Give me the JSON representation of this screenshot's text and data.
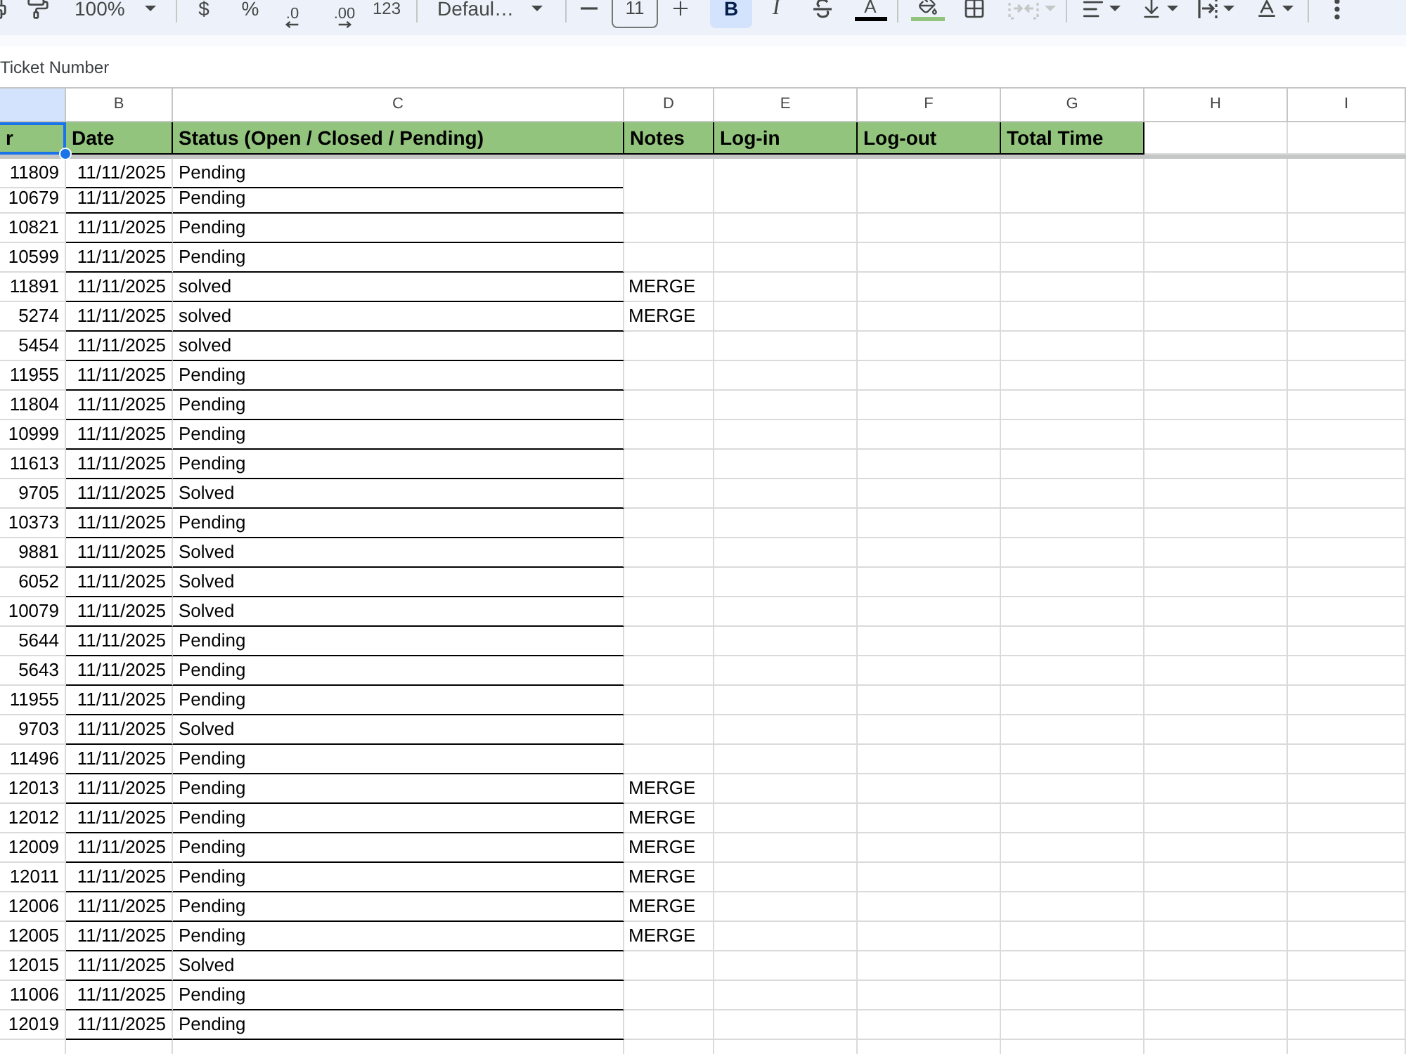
{
  "toolbar": {
    "zoom": "100%",
    "number_formats": [
      {
        "label": "$",
        "kind": "text"
      },
      {
        "label": "%",
        "kind": "text"
      },
      {
        "label": ".0",
        "kind": "decrease"
      },
      {
        "label": ".00",
        "kind": "increase"
      },
      {
        "label": "123",
        "kind": "text"
      }
    ],
    "font": "Defaul…",
    "font_size": "11",
    "bold": {
      "label": "B",
      "selected": true
    },
    "italic": {
      "label": "I",
      "selected": false
    },
    "strikethrough": {
      "selected": false
    },
    "text_color": {
      "label": "A",
      "color": "#000000"
    },
    "fill_color": {
      "color": "#93c47d"
    },
    "merge": {
      "disabled": true
    }
  },
  "formula_bar": {
    "value": "Ticket Number"
  },
  "columns": [
    "B",
    "C",
    "D",
    "E",
    "F",
    "G",
    "H",
    "I"
  ],
  "header_row": [
    {
      "text": "r",
      "selected": true
    },
    {
      "text": "Date",
      "selected": false
    },
    {
      "text": "Status (Open / Closed / Pending)",
      "selected": false
    },
    {
      "text": "Notes",
      "selected": false
    },
    {
      "text": "Log-in",
      "selected": false
    },
    {
      "text": "Log-out",
      "selected": false
    },
    {
      "text": "Total Time",
      "selected": false
    }
  ],
  "rows": [
    {
      "ticket": "11809",
      "date": "11/11/2025",
      "status": "Pending"
    },
    {
      "ticket": "10679",
      "date": "11/11/2025",
      "status": "Pending"
    },
    {
      "ticket": "10821",
      "date": "11/11/2025",
      "status": "Pending"
    },
    {
      "ticket": "10599",
      "date": "11/11/2025",
      "status": "Pending"
    },
    {
      "ticket": "11891",
      "date": "11/11/2025",
      "status": "solved",
      "notes": "MERGE"
    },
    {
      "ticket": "5274",
      "date": "11/11/2025",
      "status": "solved",
      "notes": "MERGE"
    },
    {
      "ticket": "5454",
      "date": "11/11/2025",
      "status": "solved"
    },
    {
      "ticket": "11955",
      "date": "11/11/2025",
      "status": "Pending"
    },
    {
      "ticket": "11804",
      "date": "11/11/2025",
      "status": "Pending"
    },
    {
      "ticket": "10999",
      "date": "11/11/2025",
      "status": "Pending"
    },
    {
      "ticket": "11613",
      "date": "11/11/2025",
      "status": "Pending"
    },
    {
      "ticket": "9705",
      "date": "11/11/2025",
      "status": "Solved"
    },
    {
      "ticket": "10373",
      "date": "11/11/2025",
      "status": "Pending"
    },
    {
      "ticket": "9881",
      "date": "11/11/2025",
      "status": "Solved"
    },
    {
      "ticket": "6052",
      "date": "11/11/2025",
      "status": "Solved"
    },
    {
      "ticket": "10079",
      "date": "11/11/2025",
      "status": "Solved"
    },
    {
      "ticket": "5644",
      "date": "11/11/2025",
      "status": "Pending"
    },
    {
      "ticket": "5643",
      "date": "11/11/2025",
      "status": "Pending"
    },
    {
      "ticket": "11955",
      "date": "11/11/2025",
      "status": "Pending"
    },
    {
      "ticket": "9703",
      "date": "11/11/2025",
      "status": "Solved"
    },
    {
      "ticket": "11496",
      "date": "11/11/2025",
      "status": "Pending"
    },
    {
      "ticket": "12013",
      "date": "11/11/2025",
      "status": "Pending",
      "notes": "MERGE"
    },
    {
      "ticket": "12012",
      "date": "11/11/2025",
      "status": "Pending",
      "notes": "MERGE"
    },
    {
      "ticket": "12009",
      "date": "11/11/2025",
      "status": "Pending",
      "notes": "MERGE"
    },
    {
      "ticket": "12011",
      "date": "11/11/2025",
      "status": "Pending",
      "notes": "MERGE"
    },
    {
      "ticket": "12006",
      "date": "11/11/2025",
      "status": "Pending",
      "notes": "MERGE"
    },
    {
      "ticket": "12005",
      "date": "11/11/2025",
      "status": "Pending",
      "notes": "MERGE"
    },
    {
      "ticket": "12015",
      "date": "11/11/2025",
      "status": "Solved"
    },
    {
      "ticket": "11006",
      "date": "11/11/2025",
      "status": "Pending"
    },
    {
      "ticket": "12019",
      "date": "11/11/2025",
      "status": "Pending"
    }
  ]
}
